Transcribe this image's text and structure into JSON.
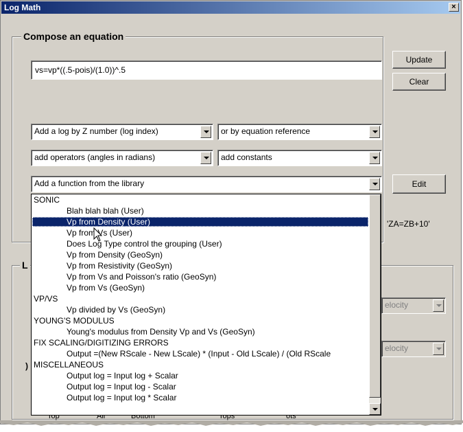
{
  "window": {
    "title": "Log Math",
    "close_glyph": "×"
  },
  "compose": {
    "title": "Compose an equation",
    "equation_value": "vs=vp*((.5-pois)/(1.0))^.5",
    "update_label": "Update",
    "clear_label": "Clear",
    "log_combo": "Add a log by Z number (log index)",
    "equation_ref_combo": "or by equation reference",
    "operators_combo": "add operators (angles in radians)",
    "constants_combo": "add constants",
    "function_combo": "Add a function from the library",
    "edit_label": "Edit",
    "example_text": "'ZA=ZB+10'"
  },
  "lower": {
    "group_title_fragment": "L",
    "velocity_combo_1": "elocity",
    "velocity_combo_2": "elocity",
    "side_fragment": ")",
    "bottom_labels": [
      "Top",
      "All",
      "Bottom",
      "Tops",
      "ots"
    ]
  },
  "dropdown": {
    "items": [
      {
        "text": "SONIC",
        "kind": "cat"
      },
      {
        "text": "Blah blah blah (User)",
        "kind": "sub"
      },
      {
        "text": "Vp from Density (User)",
        "kind": "sub",
        "selected": true
      },
      {
        "text": "Vp from Vs (User)",
        "kind": "sub"
      },
      {
        "text": "Does Log Type control the grouping (User)",
        "kind": "sub"
      },
      {
        "text": "Vp from Density (GeoSyn)",
        "kind": "sub"
      },
      {
        "text": "Vp from Resistivity (GeoSyn)",
        "kind": "sub"
      },
      {
        "text": "Vp from Vs and Poisson's ratio (GeoSyn)",
        "kind": "sub"
      },
      {
        "text": "Vp from Vs (GeoSyn)",
        "kind": "sub"
      },
      {
        "text": "VP/VS",
        "kind": "cat"
      },
      {
        "text": "Vp divided by Vs (GeoSyn)",
        "kind": "sub"
      },
      {
        "text": "YOUNG'S MODULUS",
        "kind": "cat"
      },
      {
        "text": "Young's modulus from Density Vp and Vs (GeoSyn)",
        "kind": "sub"
      },
      {
        "text": "FIX SCALING/DIGITIZING ERRORS",
        "kind": "cat"
      },
      {
        "text": "Output =(New RScale - New LScale) * (Input - Old LScale) / (Old RScale",
        "kind": "sub"
      },
      {
        "text": "MISCELLANEOUS",
        "kind": "cat"
      },
      {
        "text": "Output log = Input log + Scalar",
        "kind": "sub"
      },
      {
        "text": "Output log = Input log - Scalar",
        "kind": "sub"
      },
      {
        "text": "Output log = Input log * Scalar",
        "kind": "sub"
      }
    ]
  },
  "icons": [
    "close-icon",
    "dropdown-arrow-icon",
    "mouse-pointer-icon"
  ],
  "colors": {
    "title_bar": "#0a246a",
    "selection": "#0a246a",
    "face": "#d4d0c8"
  }
}
